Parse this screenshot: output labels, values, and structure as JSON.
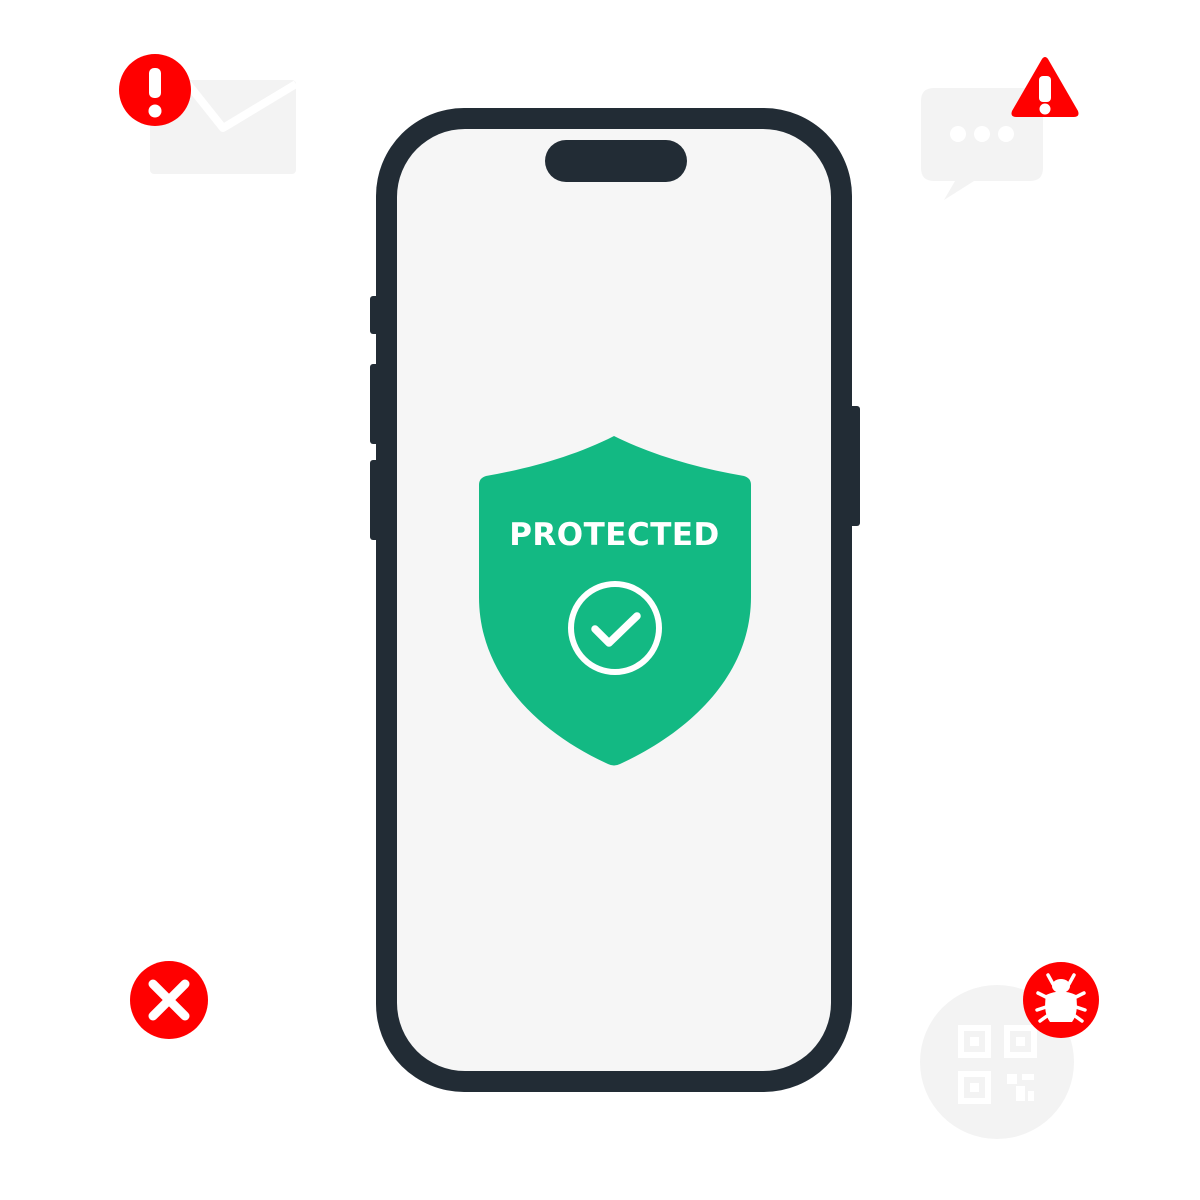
{
  "phone": {
    "screen_color": "#f6f6f6",
    "frame_color": "#222c35"
  },
  "shield": {
    "label": "PROTECTED",
    "color": "#13b983",
    "status": "protected",
    "icon": "check-circle-icon"
  },
  "threats": [
    {
      "name": "email-alert",
      "icon": "envelope-icon",
      "badge": "exclamation-circle-icon"
    },
    {
      "name": "message-alert",
      "icon": "chat-bubble-icon",
      "badge": "warning-triangle-icon"
    },
    {
      "name": "blocked",
      "icon": "x-circle-icon"
    },
    {
      "name": "qr-malware",
      "icon": "qr-code-icon",
      "badge": "bug-icon"
    }
  ],
  "colors": {
    "alert": "#ff0000",
    "faded_icon": "#f3f3f3"
  }
}
